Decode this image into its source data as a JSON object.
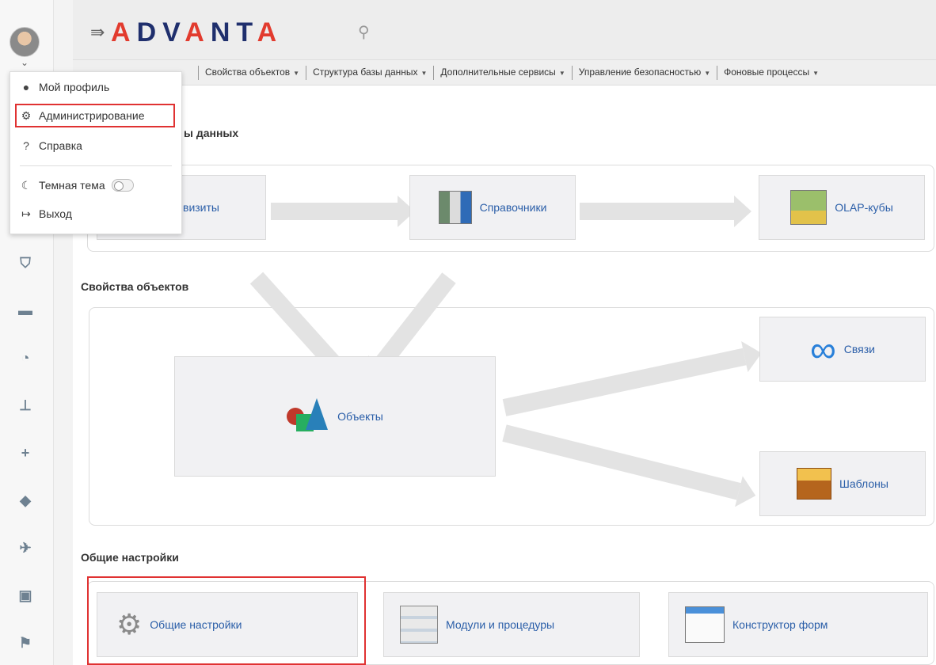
{
  "header": {
    "logo": "ADVANTA",
    "search_icon": "search-icon"
  },
  "menu": [
    {
      "label": "Свойства объектов"
    },
    {
      "label": "Структура базы данных"
    },
    {
      "label": "Дополнительные сервисы"
    },
    {
      "label": "Управление безопасностью"
    },
    {
      "label": "Фоновые процессы"
    }
  ],
  "user_menu": {
    "profile": "Мой профиль",
    "admin": "Администрирование",
    "help": "Справка",
    "dark_theme": "Темная тема",
    "dark_theme_enabled": false,
    "logout": "Выход"
  },
  "sections": {
    "data_structure_title": "ы данных",
    "object_props_title": "Свойства объектов",
    "general_settings_title": "Общие настройки"
  },
  "tiles": {
    "requisites": "визиты",
    "directories": "Справочники",
    "olap": "OLAP-кубы",
    "objects": "Объекты",
    "links": "Связи",
    "templates": "Шаблоны",
    "general_settings": "Общие настройки",
    "modules": "Модули и процедуры",
    "form_builder": "Конструктор форм"
  },
  "accent": "#e03232"
}
